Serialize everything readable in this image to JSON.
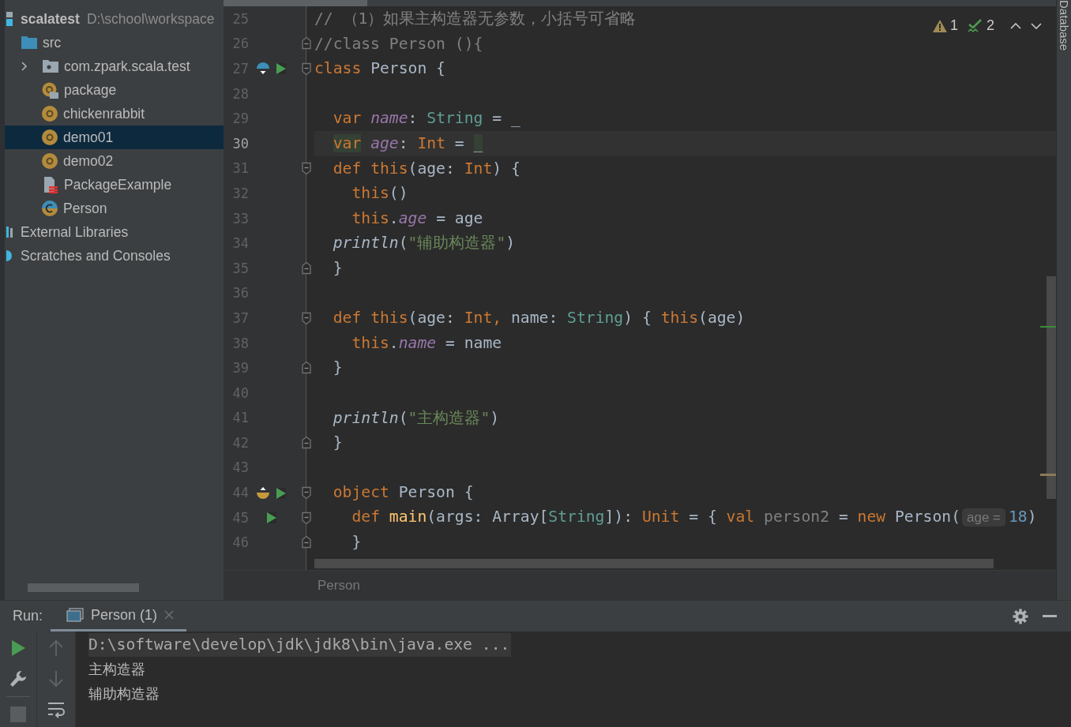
{
  "project": {
    "items": [
      {
        "label": "scalatest",
        "detail": "D:\\school\\workspace",
        "kind": "module",
        "selected": false,
        "children": [
          {
            "label": "src",
            "kind": "folder",
            "selected": false,
            "children": [
              {
                "label": "com.zpark.scala.test",
                "kind": "package",
                "expanded": false,
                "selected": false
              },
              {
                "label": "package",
                "kind": "package-object",
                "selected": false
              },
              {
                "label": "chickenrabbit",
                "kind": "object",
                "selected": false
              },
              {
                "label": "demo01",
                "kind": "object",
                "selected": true
              },
              {
                "label": "demo02",
                "kind": "object",
                "selected": false
              },
              {
                "label": "PackageExample",
                "kind": "scala-file",
                "selected": false
              },
              {
                "label": "Person",
                "kind": "class-object",
                "selected": false
              }
            ]
          }
        ]
      },
      {
        "label": "External Libraries",
        "kind": "library",
        "selected": false
      },
      {
        "label": "Scratches and Consoles",
        "kind": "scratches",
        "selected": false
      }
    ]
  },
  "editor": {
    "inspections": {
      "warnings": "1",
      "passed": "2"
    },
    "lines": [
      {
        "num": "25",
        "tokens": [
          {
            "kind": "comment",
            "text": "// （1）如果主构造器无参数，小括号可省略"
          }
        ]
      },
      {
        "num": "26",
        "fold": {
          "kind": "end"
        },
        "tokens": [
          {
            "kind": "comment",
            "text": "//class Person (){"
          }
        ]
      },
      {
        "num": "27",
        "gutter": [
          {
            "kind": "implemented"
          },
          {
            "kind": "run"
          }
        ],
        "fold": {
          "kind": "start"
        },
        "tokens": [
          {
            "kind": "kw",
            "text": "class"
          },
          {
            "kind": "plain",
            "text": " Person {"
          }
        ]
      },
      {
        "num": "28"
      },
      {
        "num": "29",
        "tokens": [
          {
            "kind": "kw",
            "text": "  var"
          },
          {
            "kind": "field",
            "text": " name"
          },
          {
            "kind": "plain",
            "text": ": "
          },
          {
            "kind": "type",
            "text": "String"
          },
          {
            "kind": "plain",
            "text": " = _"
          }
        ]
      },
      {
        "num": "30",
        "current": true,
        "tokens": [
          {
            "kind": "kw",
            "text": "  var",
            "marked": true
          },
          {
            "kind": "field",
            "text": " age",
            "marked": false
          },
          {
            "kind": "plain",
            "text": ": ",
            "marked": false
          },
          {
            "kind": "kw",
            "text": "Int",
            "marked": false
          },
          {
            "kind": "plain",
            "text": " =",
            "marked": false
          },
          {
            "kind": "plain",
            "text": " _",
            "marked": true
          }
        ]
      },
      {
        "num": "31",
        "fold": {
          "kind": "start"
        },
        "tokens": [
          {
            "kind": "kw",
            "text": "  def"
          },
          {
            "kind": "kw",
            "text": " this"
          },
          {
            "kind": "plain",
            "text": "(age: "
          },
          {
            "kind": "kw",
            "text": "Int"
          },
          {
            "kind": "plain",
            "text": ") {"
          }
        ]
      },
      {
        "num": "32",
        "tokens": [
          {
            "kind": "kw",
            "text": "    this"
          },
          {
            "kind": "plain",
            "text": "()"
          }
        ]
      },
      {
        "num": "33",
        "tokens": [
          {
            "kind": "kw",
            "text": "    this"
          },
          {
            "kind": "plain",
            "text": "."
          },
          {
            "kind": "field",
            "text": "age"
          },
          {
            "kind": "plain",
            "text": " = age"
          }
        ]
      },
      {
        "num": "34",
        "tokens": [
          {
            "kind": "call",
            "text": "  println"
          },
          {
            "kind": "plain",
            "text": "("
          },
          {
            "kind": "str",
            "text": "\"辅助构造器\""
          },
          {
            "kind": "plain",
            "text": ")"
          }
        ]
      },
      {
        "num": "35",
        "fold": {
          "kind": "end"
        },
        "tokens": [
          {
            "kind": "plain",
            "text": "  }"
          }
        ]
      },
      {
        "num": "36"
      },
      {
        "num": "37",
        "fold": {
          "kind": "start"
        },
        "tokens": [
          {
            "kind": "kw",
            "text": "  def"
          },
          {
            "kind": "kw",
            "text": " this"
          },
          {
            "kind": "plain",
            "text": "(age: "
          },
          {
            "kind": "kw",
            "text": "Int,"
          },
          {
            "kind": "plain",
            "text": " name: "
          },
          {
            "kind": "type",
            "text": "String"
          },
          {
            "kind": "plain",
            "text": ") { "
          },
          {
            "kind": "kw",
            "text": "this"
          },
          {
            "kind": "plain",
            "text": "(age)"
          }
        ]
      },
      {
        "num": "38",
        "tokens": [
          {
            "kind": "kw",
            "text": "    this"
          },
          {
            "kind": "plain",
            "text": "."
          },
          {
            "kind": "field",
            "text": "name"
          },
          {
            "kind": "plain",
            "text": " = name"
          }
        ]
      },
      {
        "num": "39",
        "fold": {
          "kind": "end"
        },
        "tokens": [
          {
            "kind": "plain",
            "text": "  }"
          }
        ]
      },
      {
        "num": "40"
      },
      {
        "num": "41",
        "tokens": [
          {
            "kind": "call",
            "text": "  println"
          },
          {
            "kind": "plain",
            "text": "("
          },
          {
            "kind": "str",
            "text": "\"主构造器\""
          },
          {
            "kind": "plain",
            "text": ")"
          }
        ]
      },
      {
        "num": "42",
        "fold": {
          "kind": "end"
        },
        "tokens": [
          {
            "kind": "plain",
            "text": "  }"
          }
        ]
      },
      {
        "num": "43"
      },
      {
        "num": "44",
        "gutter": [
          {
            "kind": "implementing"
          },
          {
            "kind": "run"
          }
        ],
        "fold": {
          "kind": "start"
        },
        "tokens": [
          {
            "kind": "kw",
            "text": "  object"
          },
          {
            "kind": "plain",
            "text": " Person {"
          }
        ]
      },
      {
        "num": "45",
        "gutter": [
          {
            "kind": "run"
          }
        ],
        "fold": {
          "kind": "start"
        },
        "tokens": [
          {
            "kind": "kw",
            "text": "    def"
          },
          {
            "kind": "method",
            "text": " main"
          },
          {
            "kind": "plain",
            "text": "(args: Array["
          },
          {
            "kind": "type",
            "text": "String"
          },
          {
            "kind": "plain",
            "text": "]): "
          },
          {
            "kind": "kw",
            "text": "Unit"
          },
          {
            "kind": "plain",
            "text": " = { "
          },
          {
            "kind": "kw",
            "text": "val"
          },
          {
            "kind": "local",
            "text": " person2"
          },
          {
            "kind": "plain",
            "text": " = "
          },
          {
            "kind": "kw",
            "text": "new"
          },
          {
            "kind": "plain",
            "text": " Person("
          },
          {
            "kind": "hint",
            "text": "age ="
          },
          {
            "kind": "num",
            "text": "18"
          },
          {
            "kind": "plain",
            "text": ")"
          }
        ]
      },
      {
        "num": "46",
        "fold": {
          "kind": "end"
        },
        "tokens": [
          {
            "kind": "plain",
            "text": "    }"
          }
        ]
      }
    ],
    "breadcrumb": "Person"
  },
  "right_strip": {
    "label": "Database"
  },
  "run": {
    "label": "Run:",
    "tab": {
      "label": "Person (1)",
      "selected": true
    },
    "left_tools": [
      {
        "kind": "run",
        "disabled": false
      },
      {
        "kind": "wrench",
        "disabled": false
      },
      {
        "kind": "stop",
        "disabled": true
      }
    ],
    "right_tools": [
      {
        "kind": "up",
        "disabled": true
      },
      {
        "kind": "down",
        "disabled": true
      },
      {
        "kind": "wrap",
        "disabled": false
      }
    ],
    "console": [
      {
        "kind": "command",
        "text": "D:\\software\\develop\\jdk\\jdk8\\bin\\java.exe ..."
      },
      {
        "kind": "output",
        "text": "主构造器"
      },
      {
        "kind": "output",
        "text": "辅助构造器"
      }
    ]
  }
}
